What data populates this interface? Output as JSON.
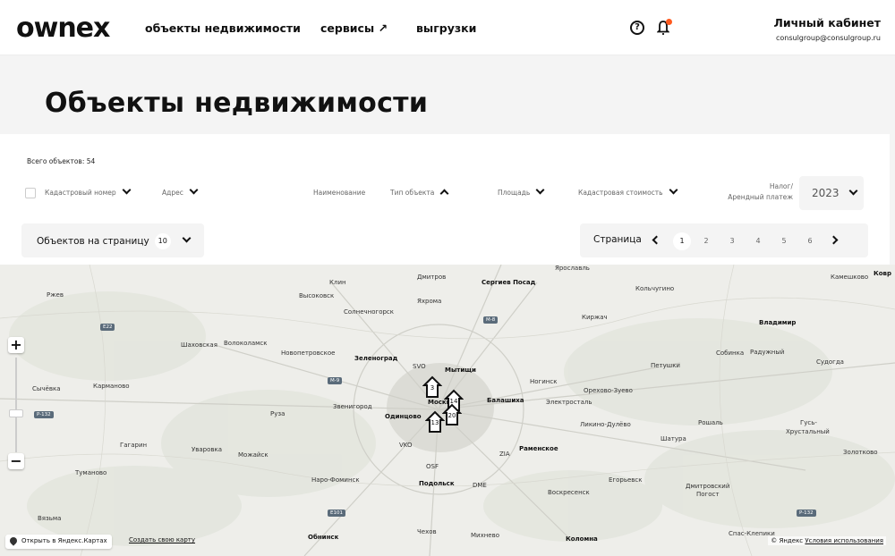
{
  "header": {
    "logo": "ownex",
    "nav": [
      "объекты недвижимости",
      "сервисы ↗",
      "выгрузки"
    ],
    "account_title": "Личный кабинет",
    "account_email": "consulgroup@consulgroup.ru",
    "icons": [
      "help-icon",
      "bell-icon"
    ],
    "notification_color": "#ff5a1f"
  },
  "page": {
    "title": "Объекты недвижимости",
    "total": "Всего объектов: 54"
  },
  "filters": {
    "cadastral_number": "Кадастровый номер",
    "address": "Адрес",
    "name": "Наименование",
    "object_type": "Тип объекта",
    "area": "Площадь",
    "cadastral_value": "Кадастровая стоимость",
    "tax_label_1": "Налог/",
    "tax_label_2": "Арендный платеж",
    "year": "2023"
  },
  "pagination": {
    "per_page_label": "Объектов на страницу",
    "per_page_value": "10",
    "page_label": "Страница",
    "pages": [
      "1",
      "2",
      "3",
      "4",
      "5",
      "6"
    ],
    "current_page": "1"
  },
  "map": {
    "cities": [
      {
        "name": "Ржев",
        "bold": false
      },
      {
        "name": "Клин",
        "bold": false
      },
      {
        "name": "Дмитров",
        "bold": false
      },
      {
        "name": "Сергиев Посад",
        "bold": true
      },
      {
        "name": "Кольчугино",
        "bold": false
      },
      {
        "name": "Камешково",
        "bold": false
      },
      {
        "name": "Ковр",
        "bold": true
      },
      {
        "name": "Высоковск",
        "bold": false
      },
      {
        "name": "Яхрома",
        "bold": false
      },
      {
        "name": "Солнечногорск",
        "bold": false
      },
      {
        "name": "Киржач",
        "bold": false
      },
      {
        "name": "Владимир",
        "bold": true
      },
      {
        "name": "Шаховская",
        "bold": false
      },
      {
        "name": "Волоколамск",
        "bold": false
      },
      {
        "name": "Новопетровское",
        "bold": false
      },
      {
        "name": "Зеленоград",
        "bold": true
      },
      {
        "name": "SVO",
        "bold": false
      },
      {
        "name": "Мытищи",
        "bold": true
      },
      {
        "name": "Петушки",
        "bold": false
      },
      {
        "name": "Собинка",
        "bold": false
      },
      {
        "name": "Радужный",
        "bold": false
      },
      {
        "name": "Судогда",
        "bold": false
      },
      {
        "name": "Сычёвка",
        "bold": false
      },
      {
        "name": "Кармановo",
        "bold": false
      },
      {
        "name": "Ногинск",
        "bold": false
      },
      {
        "name": "Орехово-Зуево",
        "bold": false
      },
      {
        "name": "Балашиха",
        "bold": true
      },
      {
        "name": "Электросталь",
        "bold": false
      },
      {
        "name": "Руза",
        "bold": false
      },
      {
        "name": "Звенигород",
        "bold": false
      },
      {
        "name": "Одинцово",
        "bold": true
      },
      {
        "name": "Ликино-Дулёво",
        "bold": false
      },
      {
        "name": "Рошаль",
        "bold": false
      },
      {
        "name": "Гусь-",
        "bold": false
      },
      {
        "name": "Хрустальный",
        "bold": false
      },
      {
        "name": "Гагарин",
        "bold": false
      },
      {
        "name": "Уваровка",
        "bold": false
      },
      {
        "name": "Можайск",
        "bold": false
      },
      {
        "name": "VKO",
        "bold": false
      },
      {
        "name": "ZIA",
        "bold": false
      },
      {
        "name": "Раменское",
        "bold": true
      },
      {
        "name": "Шатура",
        "bold": false
      },
      {
        "name": "Золотково",
        "bold": false
      },
      {
        "name": "Туманово",
        "bold": false
      },
      {
        "name": "OSF",
        "bold": false
      },
      {
        "name": "Наро-Фоминск",
        "bold": false
      },
      {
        "name": "Подольск",
        "bold": true
      },
      {
        "name": "DME",
        "bold": false
      },
      {
        "name": "Егорьевск",
        "bold": false
      },
      {
        "name": "Дмитровский",
        "bold": false
      },
      {
        "name": "Погост",
        "bold": false
      },
      {
        "name": "Воскресенск",
        "bold": false
      },
      {
        "name": "Вязьма",
        "bold": false
      },
      {
        "name": "Обнинск",
        "bold": true
      },
      {
        "name": "Чехов",
        "bold": false
      },
      {
        "name": "Михнево",
        "bold": false
      },
      {
        "name": "Коломна",
        "bold": true
      },
      {
        "name": "Спас-Клепики",
        "bold": false
      },
      {
        "name": "Москва",
        "bold": true
      },
      {
        "name": "Ярославль",
        "bold": false
      }
    ],
    "road_badges": [
      "E22",
      "M-9",
      "M-8",
      "P-132",
      "E101",
      "P-132"
    ],
    "markers": [
      "3",
      "14",
      "13",
      "20"
    ],
    "zoom_in": "+",
    "zoom_out": "−",
    "open_in_yandex": "Открыть в Яндекс.Картах",
    "create_map": "Создать свою карту",
    "attribution_prefix": "© Яндекс",
    "terms_link": "Условия использования"
  }
}
